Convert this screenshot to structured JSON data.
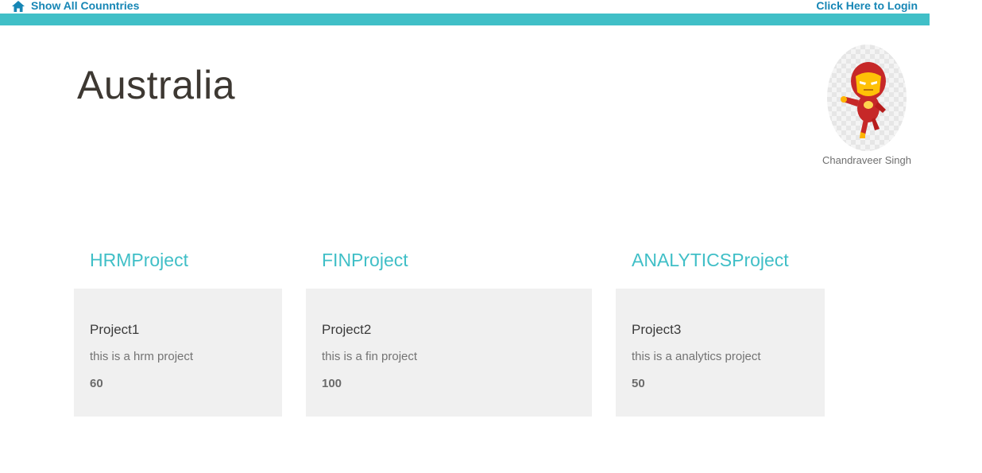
{
  "nav": {
    "home_label": "Show All Counntries",
    "home_icon": "home-icon",
    "login_label": "Click Here to Login"
  },
  "colors": {
    "link": "#1686b5",
    "accent": "#40bfc7",
    "title": "#3d3832",
    "card_bg": "#f0f0f0"
  },
  "page": {
    "title": "Australia"
  },
  "profile": {
    "name": "Chandraveer Singh",
    "avatar": "iron-man-avatar"
  },
  "projects": [
    {
      "heading": "HRMProject",
      "item_name": "Project1",
      "description": "this is a hrm project",
      "value": "60"
    },
    {
      "heading": "FINProject",
      "item_name": "Project2",
      "description": "this is a fin project",
      "value": "100"
    },
    {
      "heading": "ANALYTICSProject",
      "item_name": "Project3",
      "description": "this is a analytics project",
      "value": "50"
    }
  ]
}
